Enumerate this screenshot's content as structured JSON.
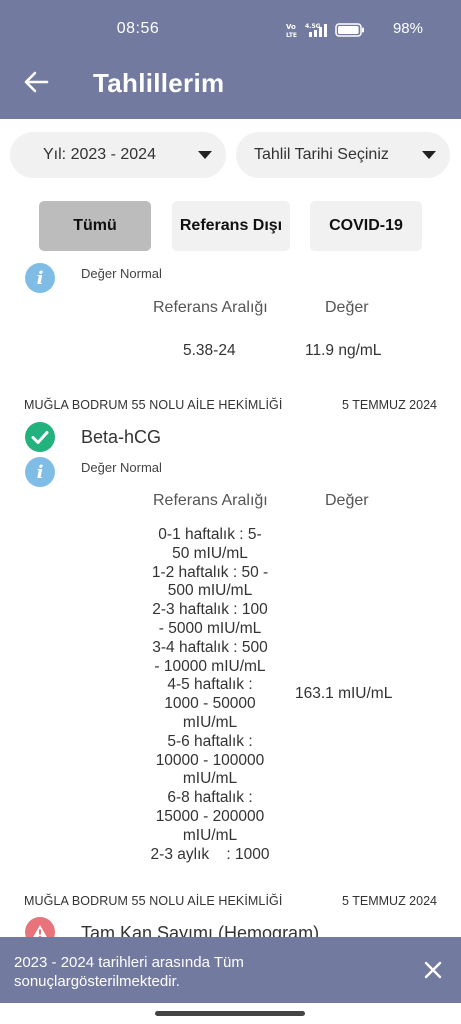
{
  "status_bar": {
    "time": "08:56",
    "network": "Vo LTE",
    "signal": "4.5G",
    "battery_percent": "98%",
    "battery_level": 0.98
  },
  "app_bar": {
    "title": "Tahlillerim",
    "back_icon": "arrow-left-icon"
  },
  "filters": {
    "year": "Yıl: 2023 - 2024",
    "date": "Tahlil Tarihi Seçiniz"
  },
  "tabs": [
    {
      "label": "Tümü",
      "active": true
    },
    {
      "label": "Referans Dışı",
      "active": false
    },
    {
      "label": "COVID-19",
      "active": false
    }
  ],
  "results": [
    {
      "status_text": "Değer Normal",
      "ref_header": "Referans Aralığı",
      "value_header": "Değer",
      "ref_range": "5.38-24",
      "value": "11.9 ng/mL"
    },
    {
      "institution": "MUĞLA BODRUM 55 NOLU AİLE HEKİMLİĞİ",
      "date": "5 TEMMUZ 2024",
      "name": "Beta-hCG",
      "status_text": "Değer Normal",
      "ref_header": "Referans Aralığı",
      "value_header": "Değer",
      "ref_lines": [
        "0-1 haftalık : 5-",
        "50 mIU/mL",
        "1-2 haftalık : 50 -",
        "500 mIU/mL",
        "2-3 haftalık : 100",
        "- 5000 mIU/mL",
        "3-4 haftalık : 500",
        "- 10000 mIU/mL",
        "4-5 haftalık :",
        "1000 - 50000",
        "mIU/mL",
        "5-6 haftalık :",
        "10000 - 100000",
        "mIU/mL",
        "6-8 haftalık :",
        "15000 - 200000",
        "mIU/mL",
        "2-3 aylık    : 1000"
      ],
      "value": "163.1 mIU/mL"
    },
    {
      "institution": "MUĞLA BODRUM 55 NOLU AİLE HEKİMLİĞİ",
      "date": "5 TEMMUZ 2024",
      "name": "Tam Kan Sayımı (Hemogram)"
    }
  ],
  "snackbar": {
    "message": "2023 - 2024 tarihleri arasında Tüm sonuçlargösterilmektedir.",
    "close_icon": "close-icon"
  },
  "colors": {
    "primary": "#737aa0",
    "ok": "#21b27d",
    "info": "#7fbde6",
    "warning": "#e9737b"
  }
}
